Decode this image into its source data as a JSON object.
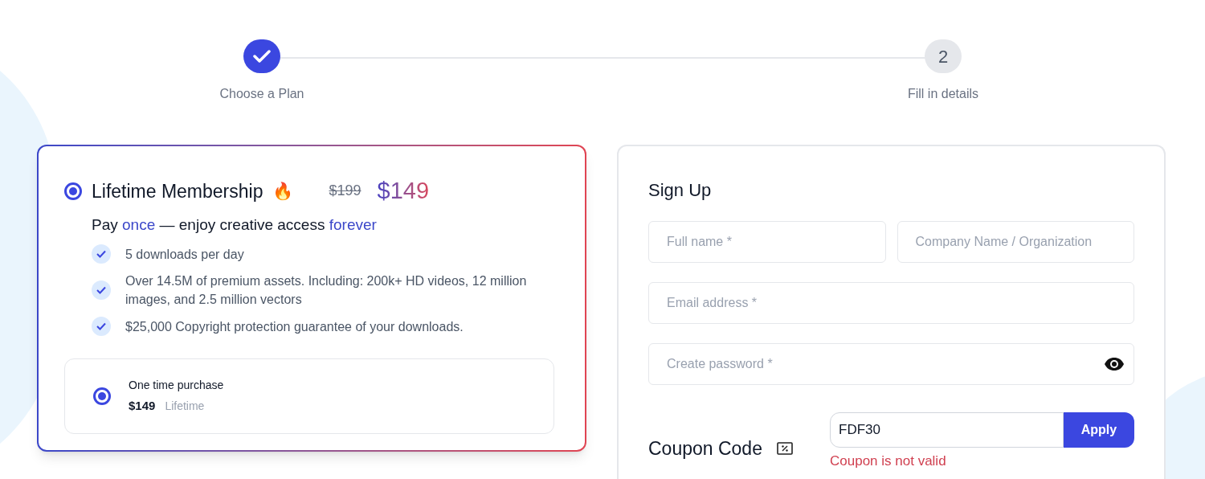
{
  "steps": [
    {
      "label": "Choose a Plan",
      "completed": true
    },
    {
      "label": "Fill in details",
      "number": "2",
      "completed": false
    }
  ],
  "plan": {
    "selected": true,
    "title": "Lifetime Membership",
    "emoji": "🔥",
    "old_price": "$199",
    "price": "$149",
    "tagline": [
      {
        "text": "Pay ",
        "highlight": false
      },
      {
        "text": "once",
        "highlight": true
      },
      {
        "text": " — enjoy creative access ",
        "highlight": false
      },
      {
        "text": "forever",
        "highlight": true
      }
    ],
    "features": [
      "5 downloads per day",
      "Over 14.5M of premium assets. Including: 200k+ HD videos, 12 million images, and 2.5 million vectors",
      "$25,000 Copyright protection guarantee of your downloads."
    ],
    "option": {
      "selected": true,
      "label": "One time purchase",
      "price": "$149",
      "period": "Lifetime"
    }
  },
  "signup": {
    "title": "Sign Up",
    "rows": [
      [
        {
          "placeholder": "Full name *"
        },
        {
          "placeholder": "Company Name / Organization"
        }
      ],
      [
        {
          "placeholder": "Email address *"
        }
      ],
      [
        {
          "placeholder": "Create password *",
          "kind": "password"
        }
      ]
    ],
    "coupon": {
      "label": "Coupon Code",
      "value": "FDF30",
      "button": "Apply",
      "error": "Coupon is not valid"
    }
  }
}
